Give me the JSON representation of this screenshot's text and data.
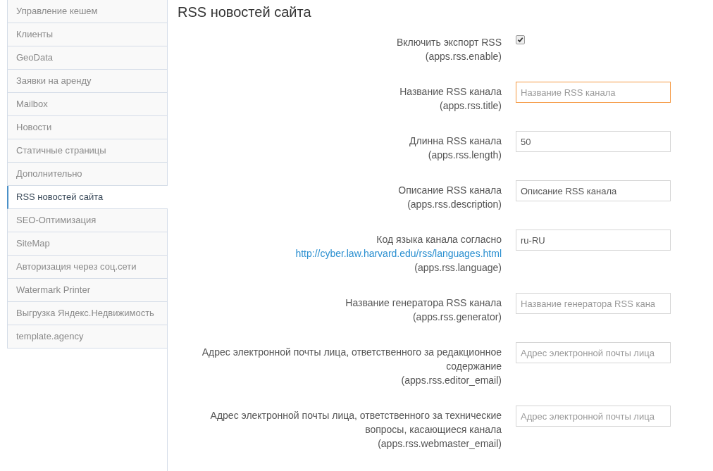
{
  "sidebar": {
    "items": [
      {
        "label": "Управление кешем",
        "selected": false
      },
      {
        "label": "Клиенты",
        "selected": false
      },
      {
        "label": "GeoData",
        "selected": false
      },
      {
        "label": "Заявки на аренду",
        "selected": false
      },
      {
        "label": "Mailbox",
        "selected": false
      },
      {
        "label": "Новости",
        "selected": false
      },
      {
        "label": "Статичные страницы",
        "selected": false
      },
      {
        "label": "Дополнительно",
        "selected": false
      },
      {
        "label": "RSS новостей сайта",
        "selected": true
      },
      {
        "label": "SEO-Оптимизация",
        "selected": false
      },
      {
        "label": "SiteMap",
        "selected": false
      },
      {
        "label": "Авторизация через соц.сети",
        "selected": false
      },
      {
        "label": "Watermark Printer",
        "selected": false
      },
      {
        "label": "Выгрузка Яндекс.Недвижимость",
        "selected": false
      },
      {
        "label": "template.agency",
        "selected": false
      }
    ]
  },
  "page_title": "RSS новостей сайта",
  "settings": [
    {
      "kind": "checkbox",
      "label": "Включить экспорт RSS",
      "key": "(apps.rss.enable)",
      "checked": true
    },
    {
      "kind": "text",
      "label": "Название RSS канала",
      "key": "(apps.rss.title)",
      "placeholder": "Название RSS канала",
      "focused": true
    },
    {
      "kind": "text",
      "label": "Длинна RSS канала",
      "key": "(apps.rss.length)",
      "value": "50",
      "focused": false
    },
    {
      "kind": "text",
      "label": "Описание RSS канала",
      "key": "(apps.rss.description)",
      "value": "Описание RSS канала",
      "focused": false
    },
    {
      "kind": "text",
      "label": "Код языка канала согласно",
      "link": "http://cyber.law.harvard.edu/rss/languages.html",
      "key": "(apps.rss.language)",
      "value": "ru-RU",
      "focused": false
    },
    {
      "kind": "text",
      "label": "Название генератора RSS канала",
      "key": "(apps.rss.generator)",
      "placeholder": "Название генератора RSS кана",
      "focused": false
    },
    {
      "kind": "text",
      "label": "Адрес электронной почты лица, ответственного за редакционное содержание",
      "key": "(apps.rss.editor_email)",
      "placeholder": "Адрес электронной почты лица",
      "focused": false
    },
    {
      "kind": "text",
      "label": "Адрес электронной почты лица, ответственного за технические вопросы, касающиеся канала",
      "key": "(apps.rss.webmaster_email)",
      "placeholder": "Адрес электронной почты лица",
      "focused": false
    }
  ]
}
